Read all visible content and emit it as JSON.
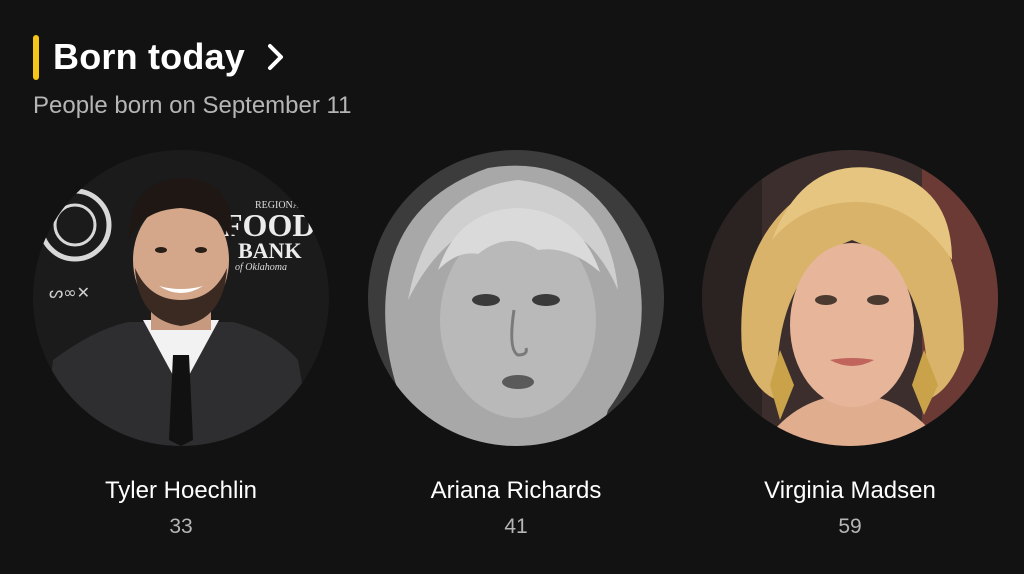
{
  "section": {
    "title": "Born today",
    "subtitle": "People born on September 11",
    "accent_color": "#f5c518",
    "chevron_icon": "chevron-right-icon"
  },
  "people": [
    {
      "name": "Tyler Hoechlin",
      "age": "33",
      "photo_style": "color"
    },
    {
      "name": "Ariana Richards",
      "age": "41",
      "photo_style": "black-and-white"
    },
    {
      "name": "Virginia Madsen",
      "age": "59",
      "photo_style": "color"
    }
  ],
  "photo_backdrop_text": {
    "line1": "REGIONAL",
    "line2": "FOOD",
    "line3": "BANK",
    "line4": "of Oklahoma"
  }
}
